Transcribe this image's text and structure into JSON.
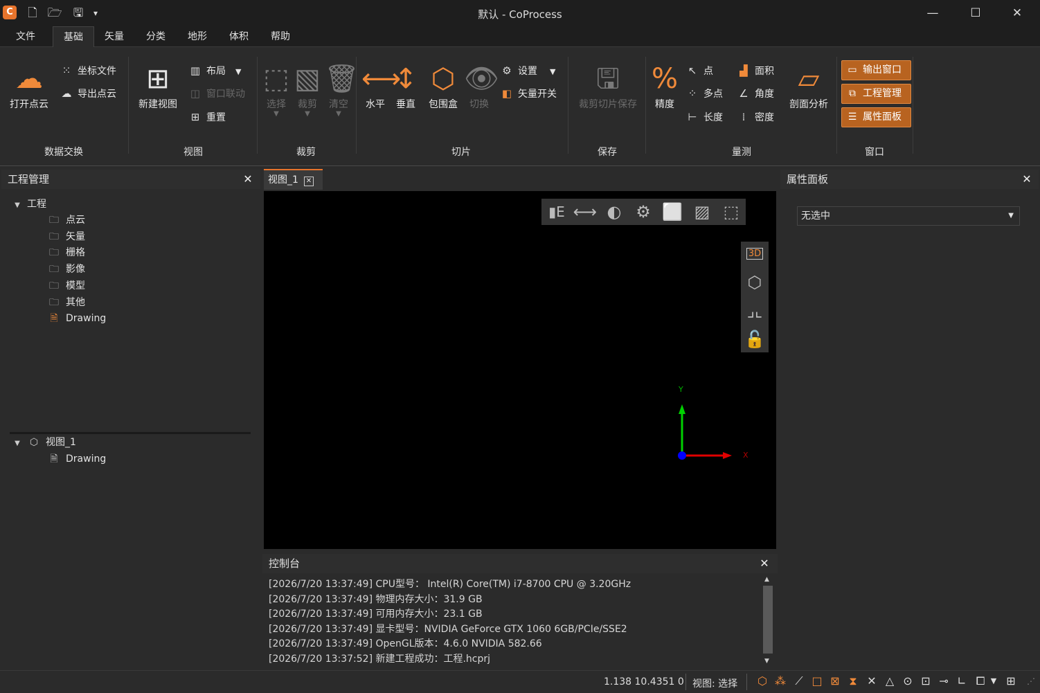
{
  "window": {
    "title": "默认 - CoProcess",
    "app_icon": "C",
    "minimize": "—",
    "maximize": "☐",
    "close": "✕"
  },
  "quick_access": [
    "new-file-icon",
    "open-folder-icon",
    "save-icon",
    "dropdown-icon"
  ],
  "menu": [
    "文件",
    "基础",
    "矢量",
    "分类",
    "地形",
    "体积",
    "帮助"
  ],
  "active_menu": "基础",
  "ribbon": {
    "groups": [
      "数据交换",
      "视图",
      "裁剪",
      "切片",
      "保存",
      "量测",
      "窗口"
    ],
    "data_exchange": {
      "open_pointcloud": "打开点云",
      "coord_file": "坐标文件",
      "export_pointcloud": "导出点云"
    },
    "view": {
      "new_view": "新建视图",
      "layout": "布局",
      "window_link": "窗口联动",
      "reset": "重置"
    },
    "clip": {
      "select": "选择",
      "clip": "裁剪",
      "clear": "清空"
    },
    "slice": {
      "horizontal": "水平",
      "vertical": "垂直",
      "bbox": "包围盒",
      "switch": "切换",
      "settings": "设置",
      "vector_switch": "矢量开关"
    },
    "save": {
      "clip_slice_save": "裁剪切片保存"
    },
    "measure": {
      "precision": "精度",
      "point": "点",
      "multi_point": "多点",
      "length": "长度",
      "area": "面积",
      "angle": "角度",
      "density": "密度",
      "profile": "剖面分析"
    },
    "window": {
      "output": "输出窗口",
      "project": "工程管理",
      "properties": "属性面板"
    }
  },
  "project_panel": {
    "title": "工程管理",
    "root": "工程",
    "folders": [
      "点云",
      "矢量",
      "栅格",
      "影像",
      "模型",
      "其他"
    ],
    "drawing": "Drawing",
    "view_node": "视图_1",
    "view_child": "Drawing"
  },
  "view_tab": "视图_1",
  "viewport": {
    "axis_x": "X",
    "axis_y": "Y",
    "toolbar_3d": "3D"
  },
  "properties_panel": {
    "title": "属性面板",
    "select_value": "无选中"
  },
  "console": {
    "title": "控制台",
    "lines": [
      "[2026/7/20 13:37:49] CPU型号：  Intel(R) Core(TM) i7-8700 CPU @ 3.20GHz",
      "[2026/7/20 13:37:49] 物理内存大小：31.9 GB",
      "[2026/7/20 13:37:49] 可用内存大小：23.1 GB",
      "[2026/7/20 13:37:49] 显卡型号：NVIDIA GeForce GTX 1060 6GB/PCIe/SSE2",
      "[2026/7/20 13:37:49] OpenGL版本：4.6.0 NVIDIA 582.66",
      "[2026/7/20 13:37:52] 新建工程成功：工程.hcprj"
    ]
  },
  "status": {
    "coords": "1.138 10.4351 0",
    "view_mode": "视图: 选择"
  },
  "colors": {
    "accent": "#e8742c",
    "bg": "#2b2b2b",
    "viewport": "#000000"
  }
}
